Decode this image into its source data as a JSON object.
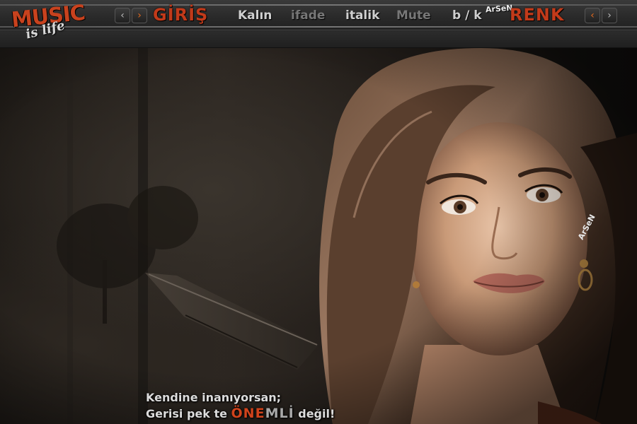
{
  "logo": {
    "main": "MUSIC",
    "sub": "is life"
  },
  "nav": {
    "prev_icon": "chevron-left-icon",
    "next_icon": "chevron-right-icon",
    "prev_glyph": "‹",
    "next_glyph": "›"
  },
  "menu": {
    "giris": "GİRİŞ",
    "kalin": "Kalın",
    "ifade": "ifade",
    "italik": "italik",
    "mute": "Mute",
    "bk": "b / k",
    "renk": "RENK"
  },
  "watermark": {
    "top": "ArSeN",
    "earring": "ArSeN"
  },
  "quote": {
    "line1": "Kendine inanıyorsan;",
    "line2_start": "Gerisi pek te ",
    "highlight1": "ÖNE",
    "highlight2": "MLİ",
    "line2_end": " değil!"
  },
  "colors": {
    "accent": "#c8421e",
    "arrow": "#e46a1e",
    "text": "#cfcfcf"
  }
}
